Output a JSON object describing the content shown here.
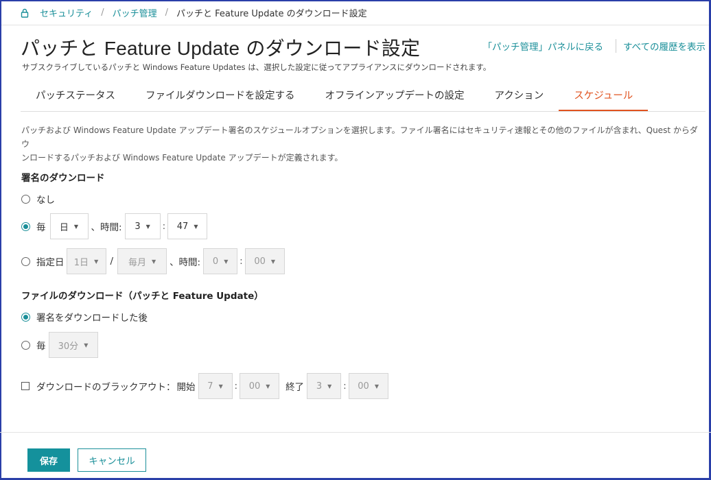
{
  "breadcrumb": {
    "items": [
      "セキュリティ",
      "パッチ管理"
    ],
    "separator": "/",
    "current": "パッチと Feature Update のダウンロード設定"
  },
  "header": {
    "title_a": "パッチと ",
    "title_b": "Feature Update",
    "title_c": " のダウンロード設定",
    "subtitle": "サブスクライブしているパッチと Windows Feature Updates は、選択した設定に従ってアプライアンスにダウンロードされます。",
    "link_back": "「パッチ管理」パネルに戻る",
    "link_history": "すべての履歴を表示"
  },
  "tabs": [
    {
      "label": "パッチステータス",
      "active": false
    },
    {
      "label": "ファイルダウンロードを設定する",
      "active": false
    },
    {
      "label": "オフラインアップデートの設定",
      "active": false
    },
    {
      "label": "アクション",
      "active": false
    },
    {
      "label": "スケジュール",
      "active": true
    }
  ],
  "description": {
    "line1": "パッチおよび Windows Feature Update アップデート署名のスケジュールオプションを選択します。ファイル署名にはセキュリティ速報とその他のファイルが含まれ、Quest からダウ",
    "line2": "ンロードするパッチおよび Windows Feature Update アップデートが定義されます。"
  },
  "signature_download": {
    "title": "署名のダウンロード",
    "none_label": "なし",
    "every_label": "毎",
    "every_unit": "日",
    "time_label": "、時間:",
    "hour": "3",
    "minute": "47",
    "specified_label": "指定日",
    "day": "1日",
    "slash": "/",
    "month": "毎月",
    "spec_time_label": "、時間:",
    "spec_hour": "0",
    "spec_minute": "00",
    "colon": ":"
  },
  "file_download": {
    "title": "ファイルのダウンロード（パッチと Feature Update）",
    "after_signature_label": "署名をダウンロードした後",
    "every_label": "毎",
    "interval": "30分"
  },
  "blackout": {
    "label": "ダウンロードのブラックアウト：",
    "start_label": "開始",
    "start_hour": "7",
    "start_minute": "00",
    "end_label": "終了",
    "end_hour": "3",
    "end_minute": "00"
  },
  "footer": {
    "save_label": "保存",
    "cancel_label": "キャンセル"
  },
  "colors": {
    "accent": "#1a8f99",
    "active_tab": "#e0531f",
    "frame": "#2a3fa8"
  }
}
